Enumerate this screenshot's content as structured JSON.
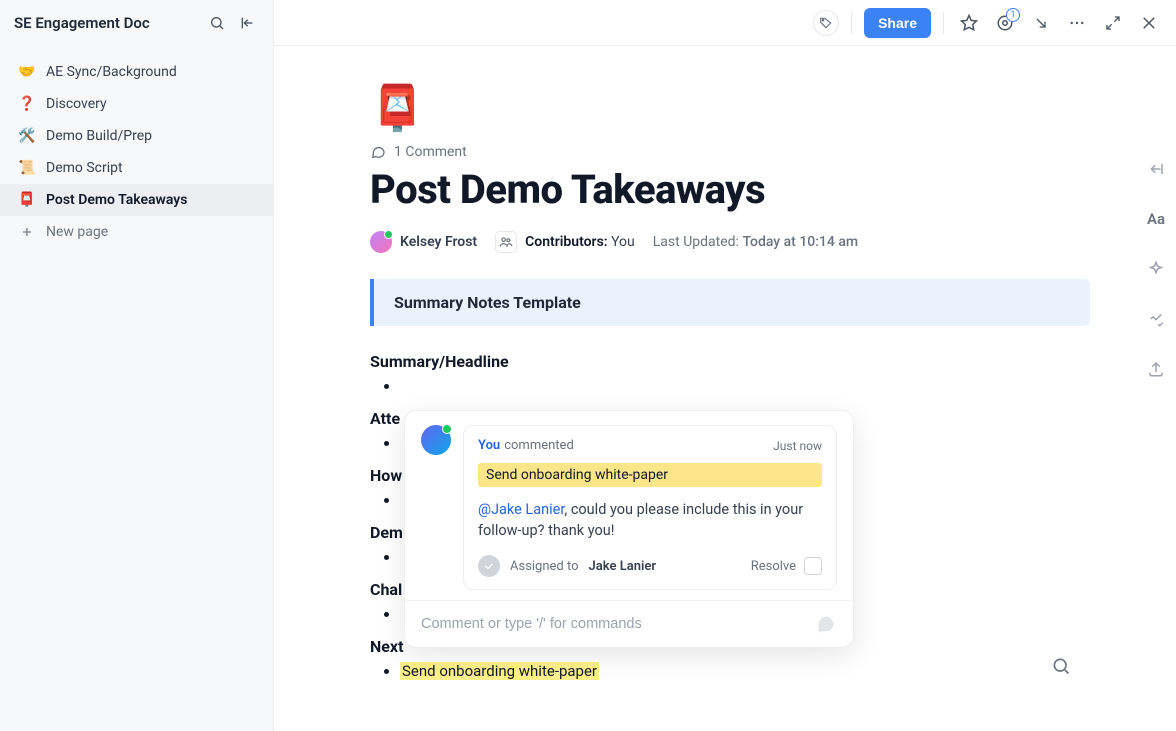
{
  "sidebar": {
    "title": "SE Engagement Doc",
    "items": [
      {
        "emoji": "🤝",
        "label": "AE Sync/Background"
      },
      {
        "emoji": "❓",
        "label": "Discovery"
      },
      {
        "emoji": "🛠️",
        "label": "Demo Build/Prep"
      },
      {
        "emoji": "📜",
        "label": "Demo Script"
      },
      {
        "emoji": "📮",
        "label": "Post Demo Takeaways"
      }
    ],
    "new_page": "New page"
  },
  "topbar": {
    "share": "Share",
    "notif_count": "1"
  },
  "doc": {
    "emoji": "📮",
    "comment_count": "1 Comment",
    "title": "Post Demo Takeaways",
    "author": "Kelsey Frost",
    "contributors_label": "Contributors:",
    "contributors_value": "You",
    "updated_label": "Last Updated:",
    "updated_value": "Today at 10:14 am",
    "callout": "Summary Notes Template",
    "sections": {
      "s1": "Summary/Headline",
      "s2": "Atte",
      "s3": "How",
      "s4": "Dem",
      "s5": "Chal",
      "s6": "Next"
    },
    "highlighted_item": "Send onboarding white-paper"
  },
  "popover": {
    "you": "You",
    "verb": "commented",
    "time": "Just now",
    "quote": "Send onboarding white-paper",
    "mention": "@Jake Lanier",
    "message_rest": ", could you please include this in your follow-up? thank you!",
    "assigned_label": "Assigned to",
    "assigned_name": "Jake Lanier",
    "resolve": "Resolve",
    "input_placeholder": "Comment or type '/' for commands"
  },
  "rightrail": {
    "aa": "Aa"
  }
}
